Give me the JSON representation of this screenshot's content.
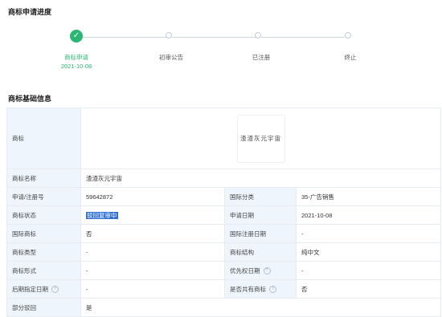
{
  "progress": {
    "title": "商标申请进度",
    "steps": [
      {
        "label": "商标申请",
        "date": "2021-10-08"
      },
      {
        "label": "初审公告"
      },
      {
        "label": "已注册"
      },
      {
        "label": "终止"
      }
    ]
  },
  "basic": {
    "title": "商标基础信息",
    "logo_label": "商标",
    "logo_text": "渣渣灰元宇宙",
    "rows": [
      {
        "l1": "商标名称",
        "v1": "渣渣灰元宇宙"
      },
      {
        "l1": "申请/注册号",
        "v1": "59642872",
        "l2": "国际分类",
        "v2": "35-广告销售"
      },
      {
        "l1": "商标状态",
        "v1": "驳回复审中",
        "l2": "申请日期",
        "v2": "2021-10-08"
      },
      {
        "l1": "国际商标",
        "v1": "否",
        "l2": "国际注册日期",
        "v2": "-"
      },
      {
        "l1": "商标类型",
        "v1": "-",
        "l2": "商标结构",
        "v2": "纯中文"
      },
      {
        "l1": "商标形式",
        "v1": "-",
        "l2": "优先权日期",
        "v2": "-"
      },
      {
        "l1": "后期指定日期",
        "v1": "-",
        "l2": "是否共有商标",
        "v2": "否"
      },
      {
        "l1": "部分驳回",
        "v1": "是"
      }
    ]
  }
}
